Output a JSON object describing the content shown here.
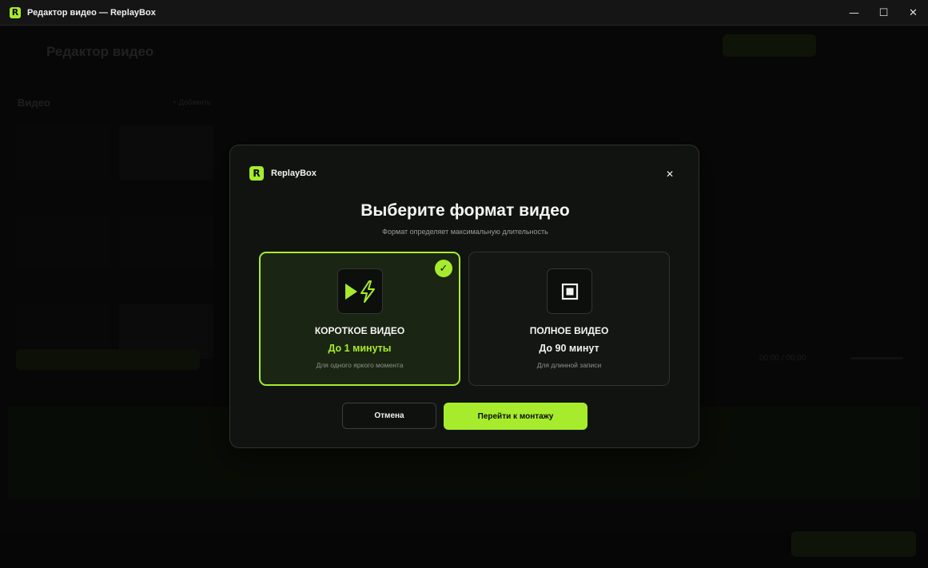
{
  "window": {
    "logo_letter": "R",
    "title": "Редактор видео — ReplayBox",
    "controls": {
      "minimize": "—",
      "maximize": "☐",
      "close": "✕"
    }
  },
  "background_editor": {
    "title": "Редактор видео",
    "section_title": "Видео",
    "add_label": "+ Добавить",
    "time_readout": "00:00 / 00:00"
  },
  "modal": {
    "brand_letter": "R",
    "brand_name": "ReplayBox",
    "close_icon": "✕",
    "title": "Выберите формат видео",
    "subtitle": "Формат определяет максимальную длительность",
    "options": [
      {
        "id": "short",
        "name": "КОРОТКОЕ ВИДЕО",
        "limit": "До 1 минуты",
        "description": "Для одного яркого момента",
        "icon": "play-bolt-icon",
        "selected": true,
        "check": "✓"
      },
      {
        "id": "full",
        "name": "ПОЛНОЕ ВИДЕО",
        "limit": "До 90 минут",
        "description": "Для длинной записи",
        "icon": "square-frame-icon",
        "selected": false
      }
    ],
    "cancel_label": "Отмена",
    "confirm_label": "Перейти к монтажу"
  },
  "colors": {
    "accent": "#a6ec2c",
    "modal_bg": "#111311",
    "selected_card_bg": "#1b2513"
  }
}
